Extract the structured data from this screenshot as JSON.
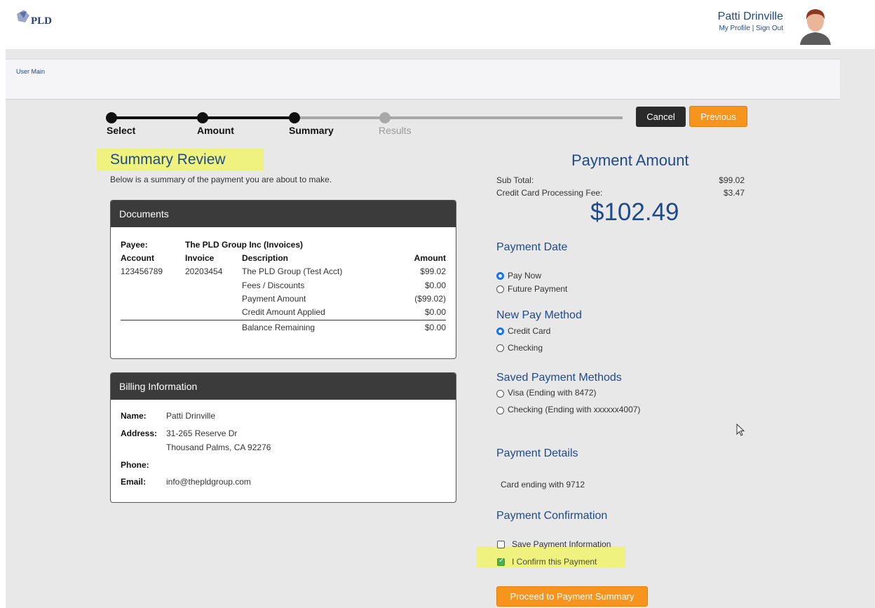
{
  "header": {
    "logo_text": "PLD",
    "user_name": "Patti Drinville",
    "my_profile": "My Profile",
    "separator": "|",
    "sign_out": "Sign Out"
  },
  "breadcrumb": {
    "label": "User Main"
  },
  "stepper": {
    "steps": [
      {
        "label": "Select",
        "state": "done"
      },
      {
        "label": "Amount",
        "state": "done"
      },
      {
        "label": "Summary",
        "state": "current"
      },
      {
        "label": "Results",
        "state": "todo"
      }
    ]
  },
  "actions": {
    "cancel": "Cancel",
    "previous": "Previous",
    "proceed": "Proceed to Payment Summary"
  },
  "summary": {
    "title": "Summary Review",
    "subtitle": "Below is a summary of the payment you are about to make."
  },
  "documents": {
    "heading": "Documents",
    "payee_label": "Payee:",
    "payee_value": "The PLD Group Inc (Invoices)",
    "columns": [
      "Account",
      "Invoice",
      "Description",
      "Amount"
    ],
    "account": "123456789",
    "invoice": "20203454",
    "rows": [
      {
        "description": "The PLD Group (Test Acct)",
        "amount": "$99.02"
      },
      {
        "description": "Fees / Discounts",
        "amount": "$0.00"
      },
      {
        "description": "Payment Amount",
        "amount": "($99.02)"
      },
      {
        "description": "Credit Amount Applied",
        "amount": "$0.00"
      }
    ],
    "balance": {
      "description": "Balance Remaining",
      "amount": "$0.00"
    }
  },
  "billing": {
    "heading": "Billing Information",
    "name_label": "Name:",
    "name": "Patti Drinville",
    "address_label": "Address:",
    "address_line1": "31-265 Reserve Dr",
    "address_line2": "Thousand Palms, CA 92276",
    "phone_label": "Phone:",
    "phone": "",
    "email_label": "Email:",
    "email": "info@thepldgroup.com"
  },
  "payment_amount": {
    "title": "Payment Amount",
    "subtotal_label": "Sub Total:",
    "subtotal": "$99.02",
    "fee_label": "Credit Card Processing Fee:",
    "fee": "$3.47",
    "total": "$102.49"
  },
  "payment_date": {
    "title": "Payment Date",
    "options": [
      "Pay Now",
      "Future Payment"
    ],
    "selected": "Pay Now"
  },
  "new_pay_method": {
    "title": "New Pay Method",
    "options": [
      "Credit Card",
      "Checking"
    ],
    "selected": "Credit Card"
  },
  "saved_methods": {
    "title": "Saved Payment Methods",
    "options": [
      "Visa (Ending with 8472)",
      "Checking (Ending with xxxxxx4007)"
    ]
  },
  "payment_details": {
    "title": "Payment Details",
    "text": "Card ending with 9712"
  },
  "confirmation": {
    "title": "Payment Confirmation",
    "save_label": "Save Payment Information",
    "save_checked": false,
    "confirm_label": "I Confirm this Payment",
    "confirm_checked": true
  },
  "colors": {
    "brand_blue": "#1f4a8a",
    "accent_orange": "#f7941d",
    "highlight": "#f0f36b"
  }
}
